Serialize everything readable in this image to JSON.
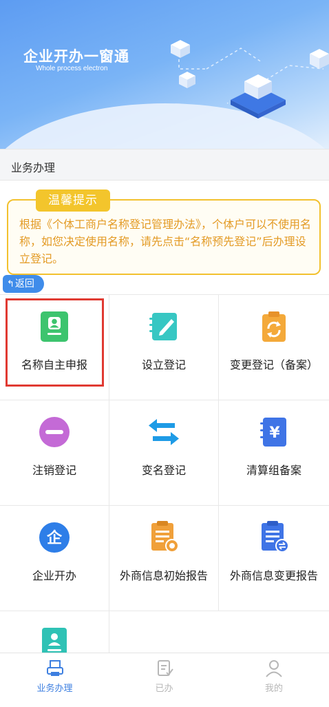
{
  "banner": {
    "title": "企业开办一窗通",
    "subtitle": "Whole process electron"
  },
  "section": {
    "title": "业务办理"
  },
  "notice": {
    "tag": "温馨提示",
    "text": "根据《个体工商户名称登记管理办法》，个体户可以不使用名称，如您决定使用名称，请先点击“名称预先登记”后办理设立登记。"
  },
  "back": {
    "label": "返回"
  },
  "services": [
    {
      "label": "名称自主申报",
      "icon": "id-card-icon"
    },
    {
      "label": "设立登记",
      "icon": "notebook-pen-icon"
    },
    {
      "label": "变更登记（备案）",
      "icon": "clipboard-refresh-icon"
    },
    {
      "label": "注销登记",
      "icon": "minus-circle-icon"
    },
    {
      "label": "变名登记",
      "icon": "swap-arrows-icon"
    },
    {
      "label": "清算组备案",
      "icon": "yuan-book-icon"
    },
    {
      "label": "企业开办",
      "icon": "enterprise-icon"
    },
    {
      "label": "外商信息初始报告",
      "icon": "report-document-icon"
    },
    {
      "label": "外商信息变更报告",
      "icon": "report-change-icon"
    },
    {
      "label": "",
      "icon": "person-card-icon"
    }
  ],
  "tabs": [
    {
      "label": "业务办理",
      "active": true
    },
    {
      "label": "已办",
      "active": false
    },
    {
      "label": "我的",
      "active": false
    }
  ],
  "colors": {
    "accent": "#3d7fe0",
    "notice": "#f3c52c",
    "notice_text": "#e39a24",
    "highlight": "#e03a32"
  }
}
